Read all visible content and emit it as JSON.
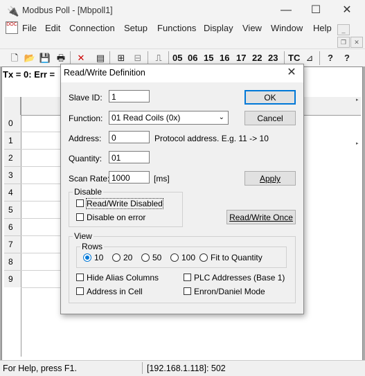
{
  "app": {
    "title": "Modbus Poll - [Mbpoll1]",
    "icon": "modbus-poll-icon",
    "controls": {
      "minimize": "—",
      "maximize": "☐",
      "close": "✕"
    }
  },
  "menu": {
    "doc_icon_text": "DOC",
    "items": [
      "File",
      "Edit",
      "Connection",
      "Setup",
      "Functions",
      "Display",
      "View",
      "Window",
      "Help"
    ],
    "mdi_controls": {
      "minimize": "_",
      "restore": "❐",
      "close": "✕"
    }
  },
  "toolbar": {
    "function_codes": [
      "05",
      "06",
      "15",
      "16",
      "17",
      "22",
      "23",
      "TC"
    ],
    "help_glyph": "?",
    "whatsthis_glyph": "?"
  },
  "child": {
    "tx_line": "Tx = 0: Err =",
    "rows": [
      "0",
      "1",
      "2",
      "3",
      "4",
      "5",
      "6",
      "7",
      "8",
      "9"
    ]
  },
  "status": {
    "help": "For Help, press F1.",
    "connection": "[192.168.1.118]: 502"
  },
  "dialog": {
    "title": "Read/Write Definition",
    "close": "✕",
    "slave_id_label": "Slave ID:",
    "slave_id_value": "1",
    "function_label": "Function:",
    "function_value": "01 Read Coils (0x)",
    "address_label": "Address:",
    "address_value": "0",
    "address_hint": "Protocol address. E.g. 11 -> 10",
    "quantity_label": "Quantity:",
    "quantity_value": "01",
    "scan_rate_label": "Scan Rate:",
    "scan_rate_value": "1000",
    "scan_rate_unit": "[ms]",
    "ok": "OK",
    "cancel": "Cancel",
    "apply": "Apply",
    "read_write_once": "Read/Write Once",
    "disable": {
      "title": "Disable",
      "rw_disabled": "Read/Write Disabled",
      "rw_disabled_checked": false,
      "disable_on_error": "Disable on error",
      "disable_on_error_checked": false
    },
    "view": {
      "title": "View",
      "rows_title": "Rows",
      "rows_options": [
        "10",
        "20",
        "50",
        "100",
        "Fit to Quantity"
      ],
      "rows_selected": "10",
      "hide_alias": "Hide Alias Columns",
      "plc_addresses": "PLC Addresses (Base 1)",
      "address_in_cell": "Address in Cell",
      "enron": "Enron/Daniel Mode"
    }
  }
}
